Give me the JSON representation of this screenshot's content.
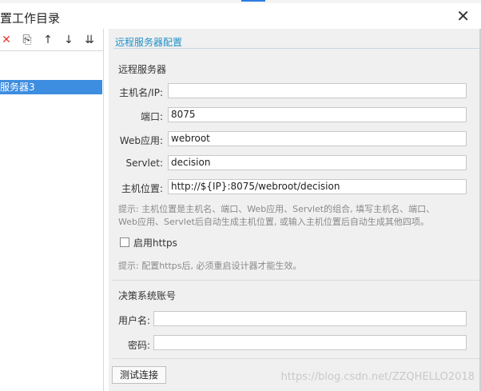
{
  "window": {
    "title": "置工作目录",
    "close_glyph": "✕"
  },
  "toolbar": {
    "delete_glyph": "✕",
    "copy_glyph": "⎘",
    "up_glyph": "↑",
    "down_glyph": "↓",
    "sort_glyph": "⇊"
  },
  "tree": {
    "selected_item": "服务器3"
  },
  "remote": {
    "section_title": "远程服务器配置",
    "group_title": "远程服务器",
    "host_label": "主机名/IP:",
    "host_value": "",
    "port_label": "端口:",
    "port_value": "8075",
    "webapp_label": "Web应用:",
    "webapp_value": "webroot",
    "servlet_label": "Servlet:",
    "servlet_value": "decision",
    "location_label": "主机位置:",
    "location_value": "http://${IP}:8075/webroot/decision",
    "hint1_line1": "提示: 主机位置是主机名、端口、Web应用、Servlet的组合, 填写主机名、端口、",
    "hint1_line2": "Web应用、Servlet后自动生成主机位置, 或输入主机位置后自动生成其他四项。",
    "https_label": "启用https",
    "hint2": "提示: 配置https后, 必须重启设计器才能生效。"
  },
  "account": {
    "group_title": "决策系统账号",
    "user_label": "用户名:",
    "user_value": "",
    "password_label": "密码:",
    "password_value": ""
  },
  "actions": {
    "test_button": "测试连接"
  },
  "watermark": "https://blog.csdn.net/ZZQHELLO2018"
}
